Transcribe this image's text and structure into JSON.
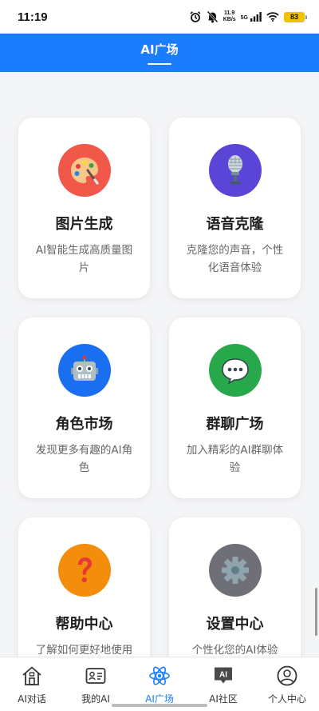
{
  "status_bar": {
    "time": "11:19",
    "net_speed_value": "11.9",
    "net_speed_unit": "KB/s",
    "net_type": "5G",
    "battery": "83"
  },
  "header": {
    "title": "AI广场"
  },
  "cards": [
    {
      "name": "图片生成",
      "desc": "AI智能生成高质量图片",
      "icon": "palette-icon",
      "color": "#f2584a"
    },
    {
      "name": "语音克隆",
      "desc": "克隆您的声音，个性化语音体验",
      "icon": "microphone-icon",
      "color": "#5b45d6"
    },
    {
      "name": "角色市场",
      "desc": "发现更多有趣的AI角色",
      "icon": "robot-icon",
      "color": "#1a6ff0"
    },
    {
      "name": "群聊广场",
      "desc": "加入精彩的AI群聊体验",
      "icon": "speech-bubble-icon",
      "color": "#27a84a"
    },
    {
      "name": "帮助中心",
      "desc": "了解如何更好地使用",
      "icon": "question-mark-icon",
      "color": "#f58d0c"
    },
    {
      "name": "设置中心",
      "desc": "个性化您的AI体验",
      "icon": "gear-icon",
      "color": "#6f6f77"
    }
  ],
  "bottom_nav": {
    "items": [
      {
        "label": "AI对话",
        "icon": "house-icon",
        "active": false
      },
      {
        "label": "我的AI",
        "icon": "id-card-icon",
        "active": false
      },
      {
        "label": "AI广场",
        "icon": "atom-icon",
        "active": true
      },
      {
        "label": "AI社区",
        "icon": "ai-chat-icon",
        "active": false
      },
      {
        "label": "个人中心",
        "icon": "user-circle-icon",
        "active": false
      }
    ]
  }
}
